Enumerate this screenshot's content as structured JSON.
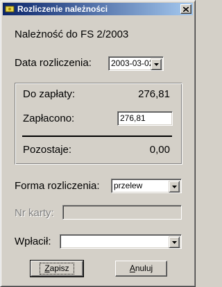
{
  "window": {
    "title": "Rozliczenie należności",
    "close_symbol": "X"
  },
  "heading": "Należność do FS 2/2003",
  "data_rozliczenia": {
    "label": "Data rozliczenia:",
    "value": "2003-03-02"
  },
  "summary": {
    "do_zaplaty_label": "Do zapłaty:",
    "do_zaplaty_value": "276,81",
    "zaplacono_label": "Zapłacono:",
    "zaplacono_value": "276,81",
    "pozostaje_label": "Pozostaje:",
    "pozostaje_value": "0,00"
  },
  "forma_rozliczenia": {
    "label": "Forma rozliczenia:",
    "value": "przelew"
  },
  "nr_karty": {
    "label": "Nr karty:",
    "value": ""
  },
  "wplacil": {
    "label": "Wpłacił:",
    "value": ""
  },
  "buttons": {
    "save_first": "Z",
    "save_rest": "apisz",
    "cancel_first": "A",
    "cancel_rest": "nuluj"
  },
  "icons": {
    "title": "money-icon",
    "combo": "dropdown-arrow-icon"
  }
}
